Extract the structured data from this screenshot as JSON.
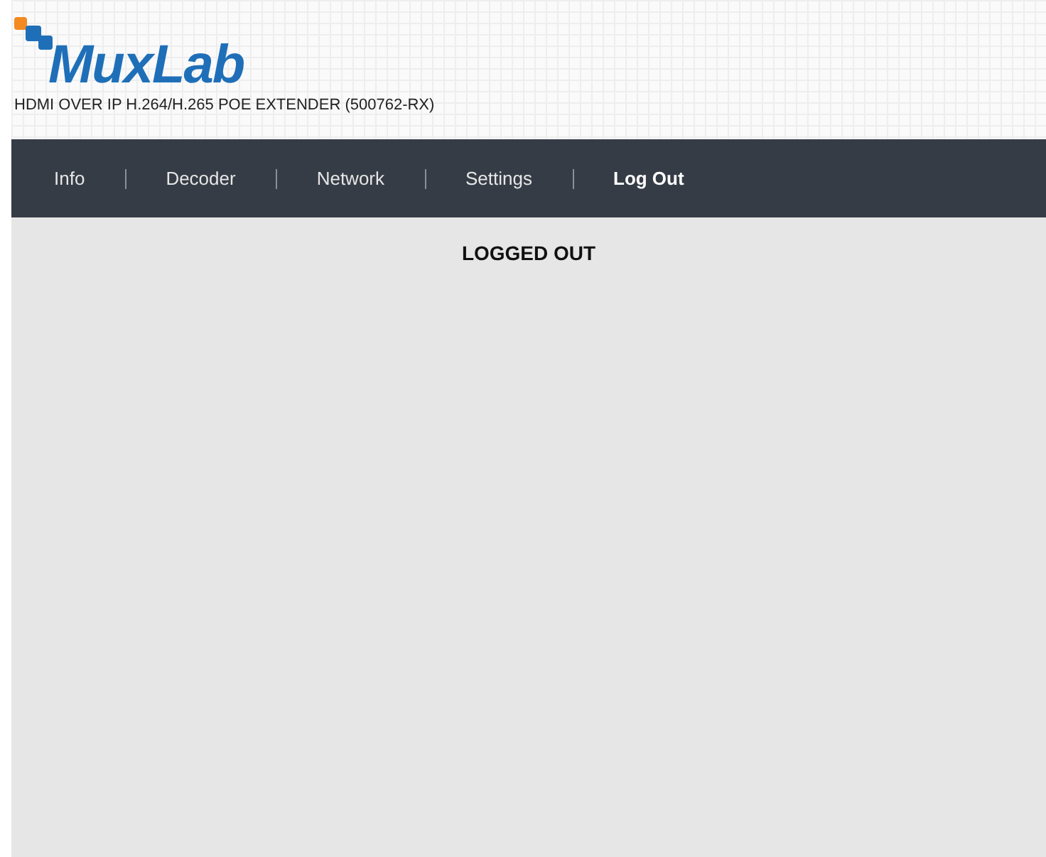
{
  "header": {
    "logo": "MuxLab",
    "product": "HDMI OVER IP H.264/H.265 POE EXTENDER (500762-RX)"
  },
  "nav": [
    {
      "label": "Info",
      "selected": false
    },
    {
      "label": "Decoder",
      "selected": false
    },
    {
      "label": "Network",
      "selected": false
    },
    {
      "label": "Settings",
      "selected": false
    },
    {
      "label": "Log Out",
      "selected": true
    }
  ],
  "main": {
    "message": "LOGGED OUT"
  }
}
